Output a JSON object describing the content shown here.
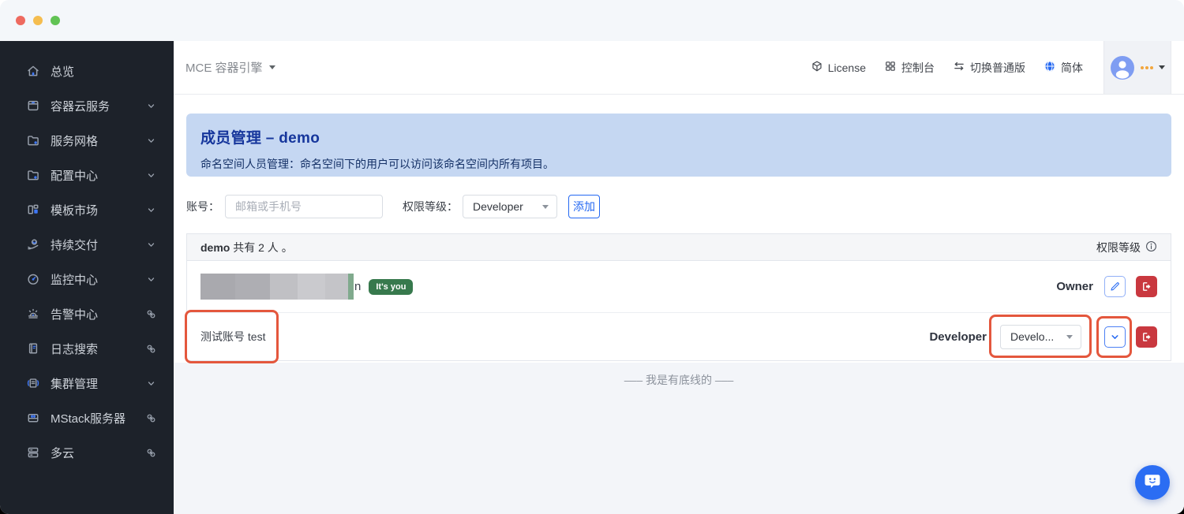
{
  "colors": {
    "accent_blue": "#2468f2",
    "danger_red": "#c9383f",
    "annotation_red": "#e4573d",
    "badge_green": "#37794d",
    "banner_bg": "#c5d7f2",
    "banner_title_blue": "#16369c",
    "sidebar_bg": "#1d222a",
    "avatar_blue": "#7f9df2",
    "page_bg": "#f3f5f9"
  },
  "sidebar": {
    "items": [
      {
        "label": "总览"
      },
      {
        "label": "容器云服务"
      },
      {
        "label": "服务网格"
      },
      {
        "label": "配置中心"
      },
      {
        "label": "模板市场"
      },
      {
        "label": "持续交付"
      },
      {
        "label": "监控中心"
      },
      {
        "label": "告警中心"
      },
      {
        "label": "日志搜索"
      },
      {
        "label": "集群管理"
      },
      {
        "label": "MStack服务器"
      },
      {
        "label": "多云"
      }
    ]
  },
  "header": {
    "product_switcher": "MCE 容器引擎",
    "license": "License",
    "console": "控制台",
    "switch_edition": "切换普通版",
    "locale": "简体"
  },
  "banner": {
    "title": "成员管理 – demo",
    "subtitle": "命名空间人员管理：命名空间下的用户可以访问该命名空间内所有项目。"
  },
  "form": {
    "account_label": "账号：",
    "account_placeholder": "邮箱或手机号",
    "role_label": "权限等级：",
    "role_value": "Developer",
    "add_button": "添加"
  },
  "table": {
    "summary_name": "demo",
    "summary_rest": " 共有 2 人 。",
    "role_column": "权限等级",
    "rows": [
      {
        "name_fragment": "n",
        "badge": "It's you",
        "role": "Owner"
      },
      {
        "name": "测试账号 test",
        "role": "Developer",
        "role_select_value": "Develo..."
      }
    ]
  },
  "footer": {
    "note": "––– 我是有底线的 –––"
  }
}
